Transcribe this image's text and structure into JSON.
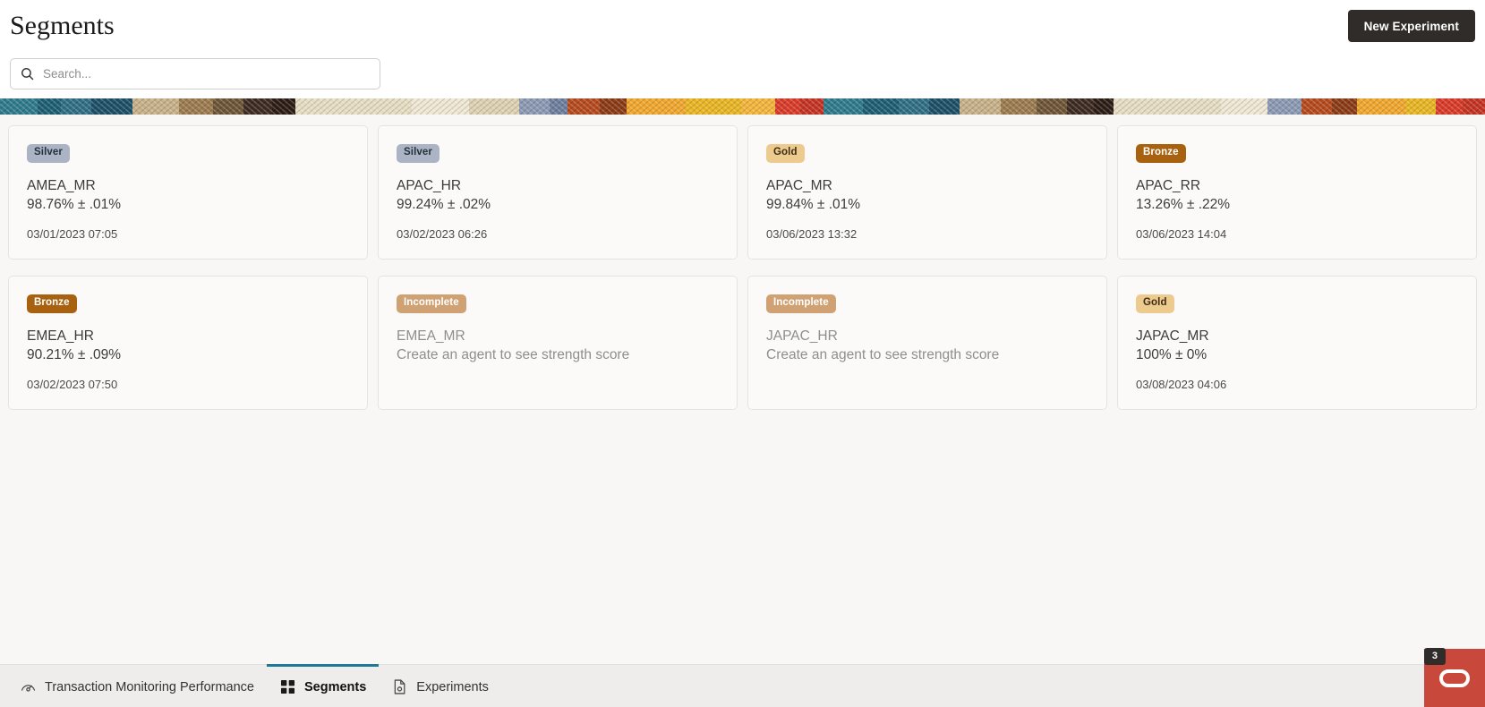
{
  "header": {
    "title": "Segments",
    "new_experiment_label": "New Experiment",
    "search_placeholder": "Search...",
    "search_value": ""
  },
  "theme": {
    "button_bg": "#2f2c29",
    "active_tab_underline": "#1c7a96",
    "badge_silver_bg": "#aab4c4",
    "badge_gold_bg": "#edca8e",
    "badge_bronze_bg": "#a8620f",
    "badge_incomplete_bg": "#cfa173",
    "chat_widget_bg": "#c8483b",
    "content_bg": "#f8f7f5"
  },
  "banner": {
    "colors": [
      "#2d7a8c",
      "#1d5c72",
      "#c8b48c",
      "#8a6b44",
      "#e8dcc4",
      "#3c2a20",
      "#d9cba8",
      "#7b8ba8",
      "#b5401a",
      "#f0a530",
      "#e5b020",
      "#d93a28",
      "#2f6e84",
      "#4a3326",
      "#efe5cf"
    ]
  },
  "cards": [
    {
      "badge": "Silver",
      "badge_class": "silver",
      "name": "AMEA_MR",
      "score": "98.76% ± .01%",
      "time": "03/01/2023 07:05",
      "muted": false
    },
    {
      "badge": "Silver",
      "badge_class": "silver",
      "name": "APAC_HR",
      "score": "99.24% ± .02%",
      "time": "03/02/2023 06:26",
      "muted": false
    },
    {
      "badge": "Gold",
      "badge_class": "gold",
      "name": "APAC_MR",
      "score": "99.84% ± .01%",
      "time": "03/06/2023 13:32",
      "muted": false
    },
    {
      "badge": "Bronze",
      "badge_class": "bronze",
      "name": "APAC_RR",
      "score": "13.26% ± .22%",
      "time": "03/06/2023 14:04",
      "muted": false
    },
    {
      "badge": "Bronze",
      "badge_class": "bronze",
      "name": "EMEA_HR",
      "score": "90.21% ± .09%",
      "time": "03/02/2023 07:50",
      "muted": false
    },
    {
      "badge": "Incomplete",
      "badge_class": "incomplete",
      "name": "EMEA_MR",
      "score": "Create an agent to see strength score",
      "time": "",
      "muted": true
    },
    {
      "badge": "Incomplete",
      "badge_class": "incomplete",
      "name": "JAPAC_HR",
      "score": "Create an agent to see strength score",
      "time": "",
      "muted": true
    },
    {
      "badge": "Gold",
      "badge_class": "gold",
      "name": "JAPAC_MR",
      "score": "100% ± 0%",
      "time": "03/08/2023 04:06",
      "muted": false
    }
  ],
  "bottom_nav": {
    "items": [
      {
        "label": "Transaction Monitoring Performance",
        "icon": "gauge-icon",
        "active": false
      },
      {
        "label": "Segments",
        "icon": "grid-icon",
        "active": true
      },
      {
        "label": "Experiments",
        "icon": "document-icon",
        "active": false
      }
    ]
  },
  "chat": {
    "badge_count": "3",
    "logo": "oracle-logo"
  }
}
